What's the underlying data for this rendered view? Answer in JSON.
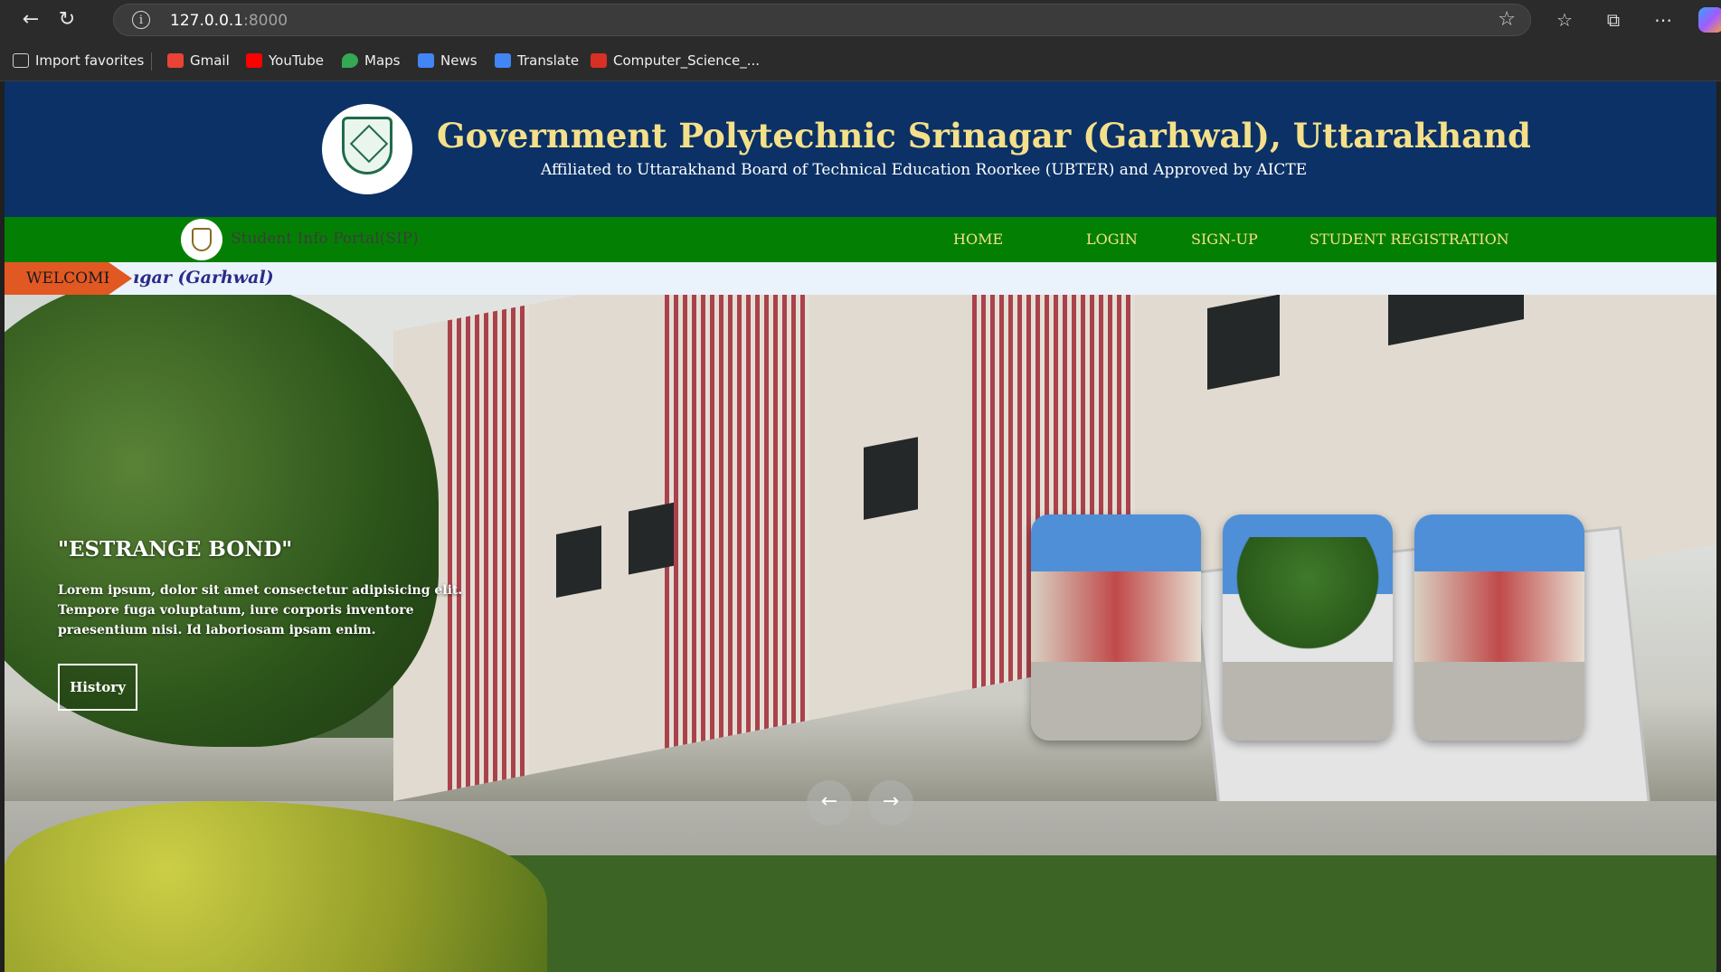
{
  "browser": {
    "address": {
      "host": "127.0.0.1",
      "port": ":8000"
    },
    "bookmarks": [
      {
        "label": "Import favorites",
        "icon": "import-icon",
        "color": "#cfcfcf"
      },
      {
        "label": "Gmail",
        "icon": "gmail-icon",
        "color": "#ea4335"
      },
      {
        "label": "YouTube",
        "icon": "youtube-icon",
        "color": "#ff0000"
      },
      {
        "label": "Maps",
        "icon": "maps-icon",
        "color": "#34a853"
      },
      {
        "label": "News",
        "icon": "news-icon",
        "color": "#4285f4"
      },
      {
        "label": "Translate",
        "icon": "translate-icon",
        "color": "#4285f4"
      },
      {
        "label": "Computer_Science_...",
        "icon": "pdf-icon",
        "color": "#d93025"
      }
    ]
  },
  "header": {
    "title": "Government Polytechnic Srinagar (Garhwal), Uttarakhand",
    "subtitle": "Affiliated to Uttarakhand Board of Technical Education Roorkee (UBTER) and Approved by AICTE"
  },
  "navbar": {
    "portal_name": "Student Info Portal(SIP)",
    "links": [
      "HOME",
      "LOGIN",
      "SIGN-UP",
      "STUDENT REGISTRATION"
    ]
  },
  "ticker": {
    "badge": "WELCOME",
    "text": "ıgar (Garhwal)"
  },
  "hero": {
    "title": "\"ESTRANGE BOND\"",
    "description": "Lorem ipsum, dolor sit amet consectetur adipisicing elit. Tempore fuga voluptatum, iure corporis inventore praesentium nisi. Id laboriosam ipsam enim.",
    "button_label": "History",
    "prev_icon": "←",
    "next_icon": "→"
  },
  "colors": {
    "header_bg": "#0b3166",
    "title_color": "#f5e08a",
    "navbar_bg": "#038003",
    "welcome_bg": "#e25822"
  }
}
